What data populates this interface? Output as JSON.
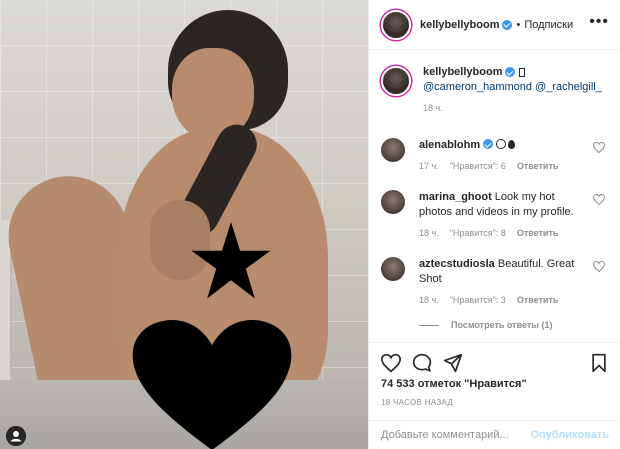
{
  "post": {
    "author": "kellybellyboom",
    "separator": "•",
    "follow_label": "Подписки",
    "caption_mentions": "@cameron_hammond @_rachelgill_",
    "caption_time": "18 ч."
  },
  "comments": [
    {
      "user": "alenablohm",
      "text": "",
      "time": "17 ч.",
      "likes": "\"Нравится\": 6",
      "reply_label": "Ответить"
    },
    {
      "user": "marina_ghoot",
      "text": "Look my hot photos and videos in my profile.",
      "time": "18 ч.",
      "likes": "\"Нравится\": 8",
      "reply_label": "Ответить"
    },
    {
      "user": "aztecstudiosla",
      "text": "Beautiful. Great Shot",
      "time": "18 ч.",
      "likes": "\"Нравится\": 3",
      "reply_label": "Ответить"
    }
  ],
  "view_replies": "Посмотреть ответы (1)",
  "likes_count": "74 533 отметок \"Нравится\"",
  "posted_ago": "18 ЧАСОВ НАЗАД",
  "comment_input": {
    "placeholder": "Добавьте комментарий...",
    "value": ""
  },
  "publish_label": "Опубликовать",
  "colors": {
    "verified": "#3897f0",
    "link": "#00376b",
    "muted": "#8e8e8e",
    "publish_disabled": "#b2dffc"
  }
}
